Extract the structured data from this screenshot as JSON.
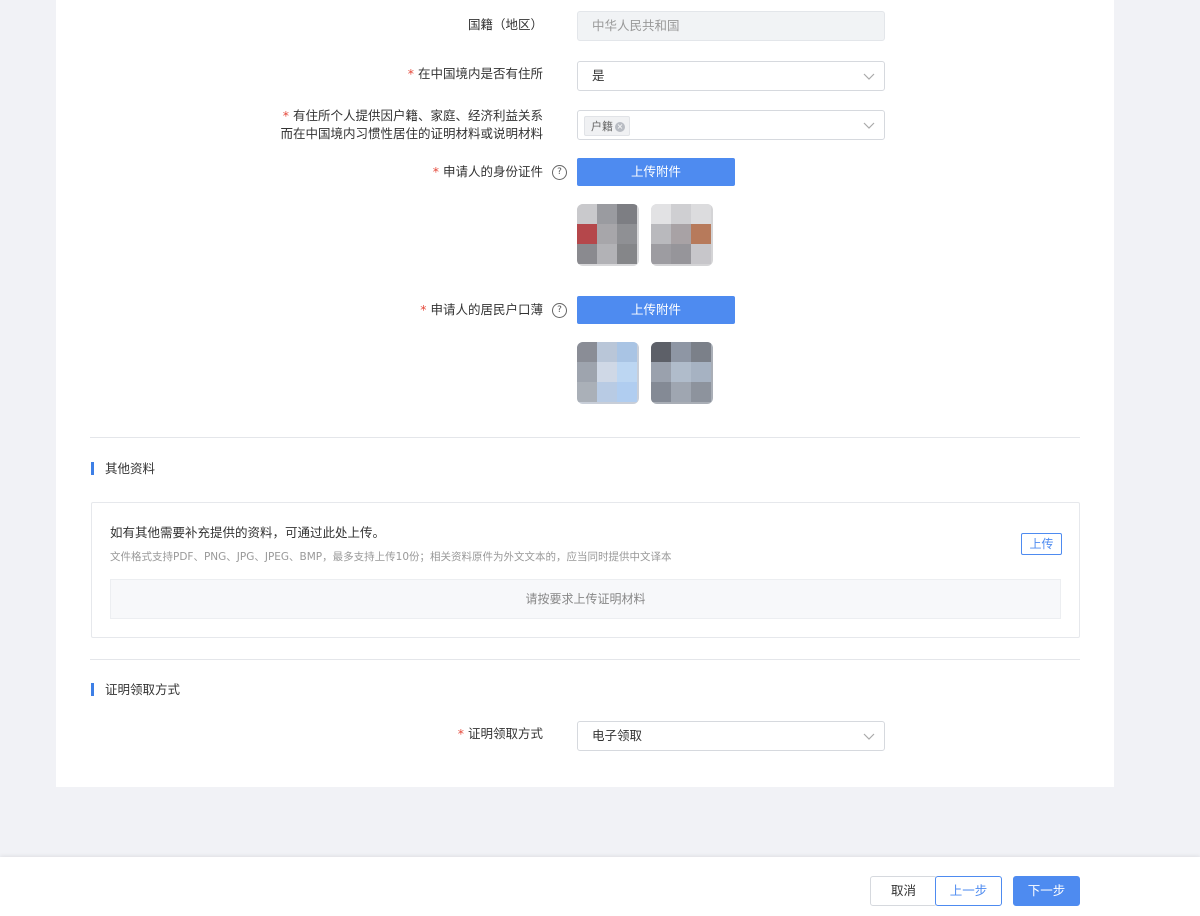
{
  "form": {
    "nationality": {
      "label": "国籍（地区）",
      "value": "中华人民共和国"
    },
    "has_residence": {
      "label": "在中国境内是否有住所",
      "value": "是"
    },
    "residence_proof": {
      "label_line1": "有住所个人提供因户籍、家庭、经济利益关系",
      "label_line2": "而在中国境内习惯性居住的证明材料或说明材料",
      "tag": "户籍"
    },
    "id_card": {
      "label": "申请人的身份证件",
      "upload_label": "上传附件"
    },
    "hukou": {
      "label": "申请人的居民户口薄",
      "upload_label": "上传附件"
    }
  },
  "other": {
    "section_title": "其他资料",
    "heading": "如有其他需要补充提供的资料，可通过此处上传。",
    "hint": "文件格式支持PDF、PNG、JPG、JPEG、BMP，最多支持上传10份；相关资料原件为外文文本的，应当同时提供中文译本",
    "upload_label": "上传",
    "empty_text": "请按要求上传证明材料"
  },
  "receipt": {
    "section_title": "证明领取方式",
    "label": "证明领取方式",
    "value": "电子领取"
  },
  "footer": {
    "cancel": "取消",
    "prev": "上一步",
    "next": "下一步"
  },
  "icons": {
    "required": "*",
    "help": "?",
    "tag_close": "×"
  },
  "colors": {
    "primary": "#4e8bf0",
    "accent_bar": "#3d7fe6",
    "required": "#e5483a"
  }
}
